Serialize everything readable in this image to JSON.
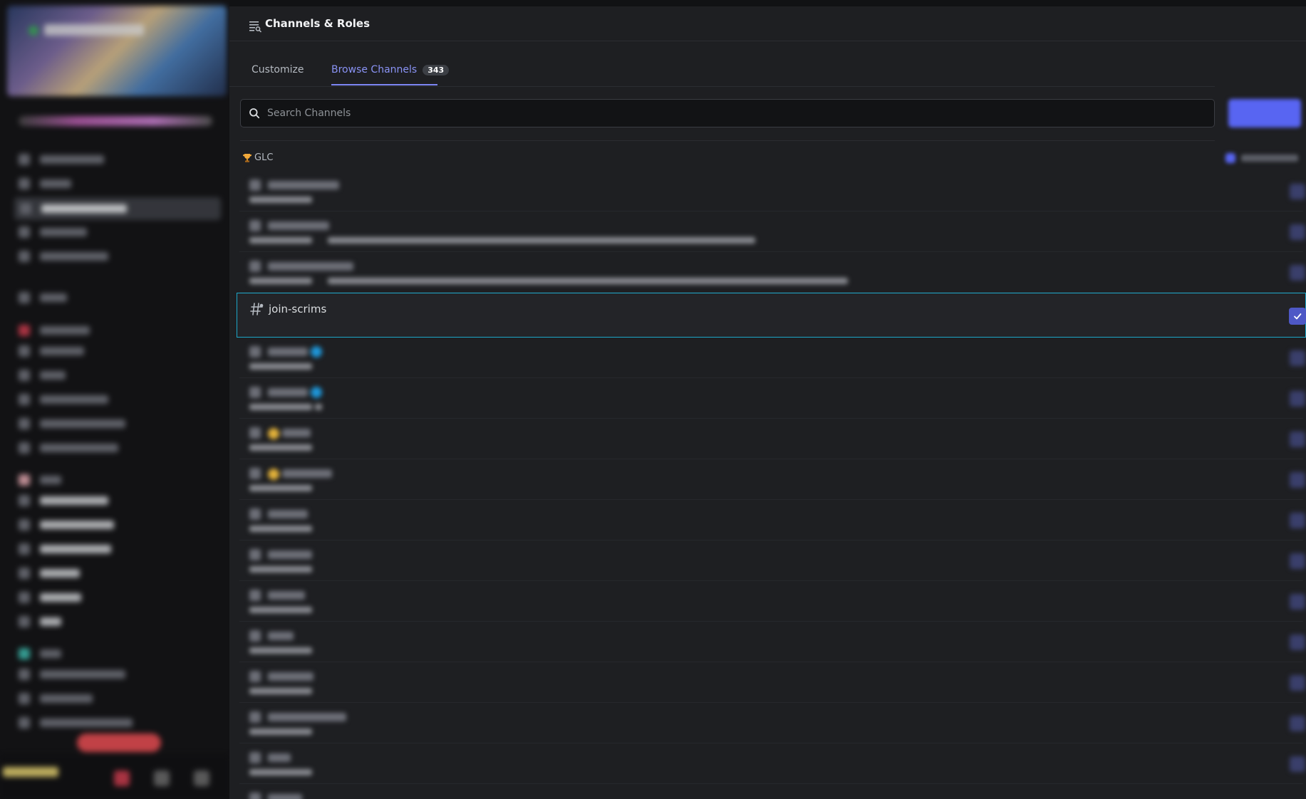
{
  "header": {
    "title": "Channels & Roles",
    "icon": "channel-browse-icon"
  },
  "tabs": [
    {
      "label": "Customize"
    },
    {
      "label": "Browse Channels",
      "count": "343",
      "active": true
    }
  ],
  "search": {
    "placeholder": "Search Channels",
    "value": ""
  },
  "category": {
    "emoji": "trophy-icon",
    "label": "GLC"
  },
  "selected_channel": {
    "name": "join-scrims",
    "followed": true
  },
  "colors": {
    "accent": "#5865f2",
    "tab_active": "#8a93f5",
    "selection_border": "#1ca7c9"
  }
}
